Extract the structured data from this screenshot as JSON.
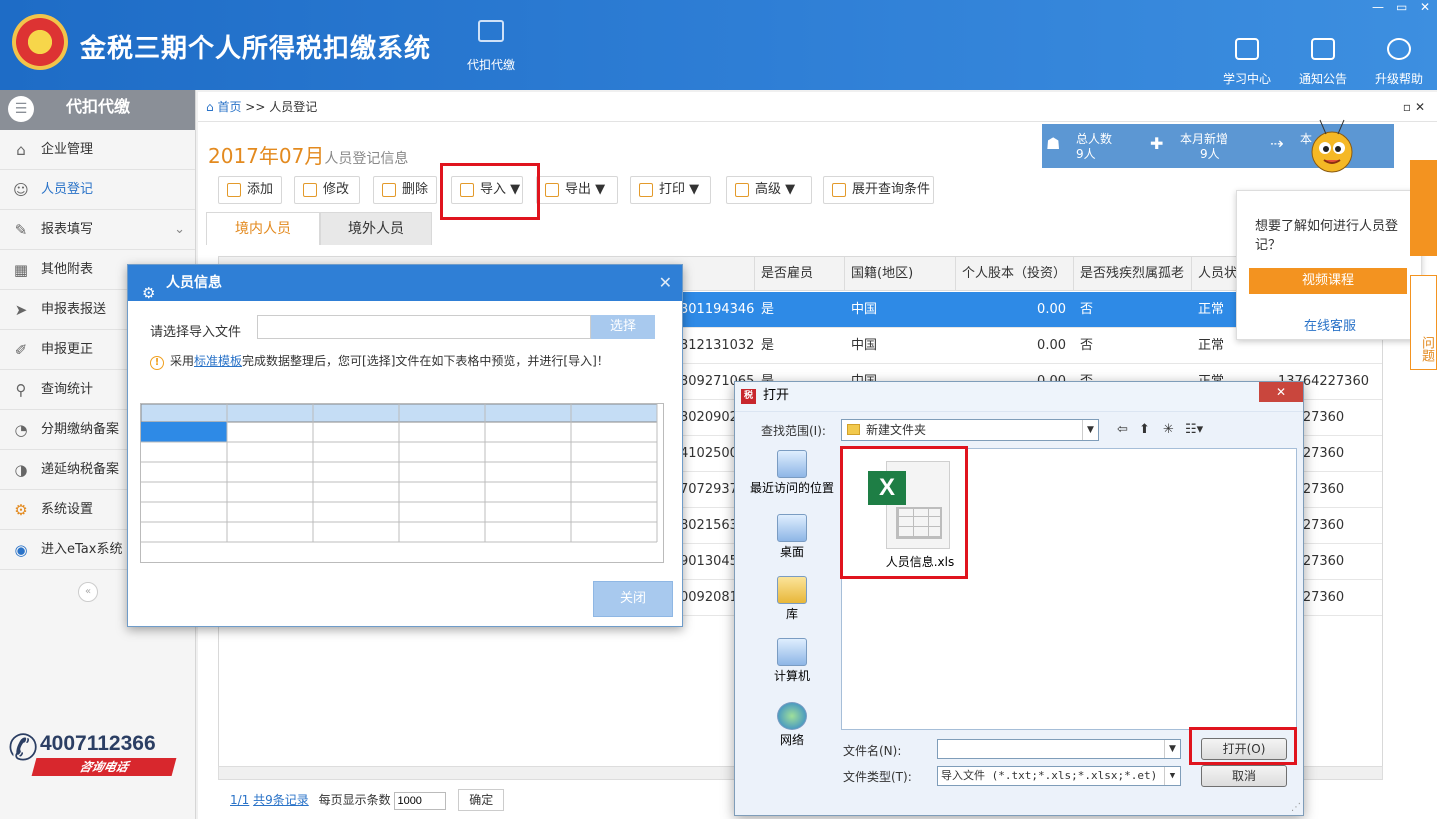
{
  "header": {
    "title": "金税三期个人所得税扣缴系统",
    "module_tab": "代扣代缴",
    "buttons": [
      "学习中心",
      "通知公告",
      "升级帮助"
    ]
  },
  "sidebar": {
    "title": "代扣代缴",
    "items": [
      {
        "label": "企业管理",
        "icon": "house-icon"
      },
      {
        "label": "人员登记",
        "icon": "person-icon"
      },
      {
        "label": "报表填写",
        "icon": "edit-icon"
      },
      {
        "label": "其他附表",
        "icon": "grid-icon"
      },
      {
        "label": "申报表报送",
        "icon": "send-icon"
      },
      {
        "label": "申报更正",
        "icon": "pen-icon"
      },
      {
        "label": "查询统计",
        "icon": "search-icon"
      },
      {
        "label": "分期缴纳备案",
        "icon": "installment-icon"
      },
      {
        "label": "递延纳税备案",
        "icon": "deferral-icon"
      },
      {
        "label": "系统设置",
        "icon": "gear-icon"
      },
      {
        "label": "进入eTax系统",
        "icon": "etax-icon"
      }
    ],
    "hotline_number": "4007112366",
    "hotline_label": "咨询电话"
  },
  "breadcrumb": {
    "home": "首页",
    "sep": ">>",
    "current": "人员登记"
  },
  "page": {
    "period": "2017年07月",
    "period_suffix": "人员登记信息"
  },
  "stats": {
    "total_label": "总人数",
    "total_value": "9人",
    "new_label": "本月新增",
    "new_value": "9人",
    "third_label": "本"
  },
  "toolbar": {
    "add": "添加",
    "edit": "修改",
    "delete": "删除",
    "import": "导入 ▼",
    "export": "导出 ▼",
    "print": "打印 ▼",
    "advanced": "高级 ▼",
    "expand": "展开查询条件"
  },
  "tabs": {
    "domestic": "境内人员",
    "foreign": "境外人员"
  },
  "grid": {
    "columns": [
      "是否雇员",
      "国籍(地区)",
      "个人股本（投资）",
      "是否残疾烈属孤老",
      "人员状"
    ],
    "rows": [
      {
        "id": "301194346",
        "employee": "是",
        "nation": "中国",
        "stock": "0.00",
        "disabled": "否",
        "status": "正常",
        "phone": ""
      },
      {
        "id": "312131032",
        "employee": "是",
        "nation": "中国",
        "stock": "0.00",
        "disabled": "否",
        "status": "正常",
        "phone": ""
      },
      {
        "id": "309271065",
        "employee": "是",
        "nation": "中国",
        "stock": "0.00",
        "disabled": "否",
        "status": "正常",
        "phone": "13764227360"
      },
      {
        "id": "30209029",
        "phone": "54227360"
      },
      {
        "id": "41025007",
        "phone": "54227360"
      },
      {
        "id": "70729374",
        "phone": "54227360"
      },
      {
        "id": "80215632",
        "phone": "54227360"
      },
      {
        "id": "90130452",
        "phone": "54227360"
      },
      {
        "id": "00920811",
        "phone": "54227360"
      }
    ]
  },
  "pager": {
    "page": "1/1",
    "total": "共9条记录",
    "per_page_label": "每页显示条数",
    "per_page_value": "1000",
    "confirm": "确定"
  },
  "help": {
    "question": "想要了解如何进行人员登记？",
    "video": "视频课程",
    "service": "在线客服",
    "right_tab": "问题"
  },
  "import_dialog": {
    "title": "人员信息",
    "file_label": "请选择导入文件",
    "select_btn": "选择",
    "tip_pre": "采用",
    "tip_link": "标准模板",
    "tip_post": "完成数据整理后，您可[选择]文件在如下表格中预览，并进行[导入]！",
    "close_btn": "关闭"
  },
  "open_dialog": {
    "title": "打开",
    "look_in_label": "查找范围(I):",
    "folder": "新建文件夹",
    "places": [
      "最近访问的位置",
      "桌面",
      "库",
      "计算机",
      "网络"
    ],
    "file_name": "人员信息.xls",
    "filename_label": "文件名(N):",
    "filetype_label": "文件类型(T):",
    "filetype_value": "导入文件 (*.txt;*.xls;*.xlsx;*.et)",
    "open_btn": "打开(O)",
    "cancel_btn": "取消"
  },
  "colors": {
    "header": "#2f7fd6",
    "accent": "#e38a1f",
    "highlight": "#e0141e",
    "selected_row": "#2e8ae6"
  }
}
